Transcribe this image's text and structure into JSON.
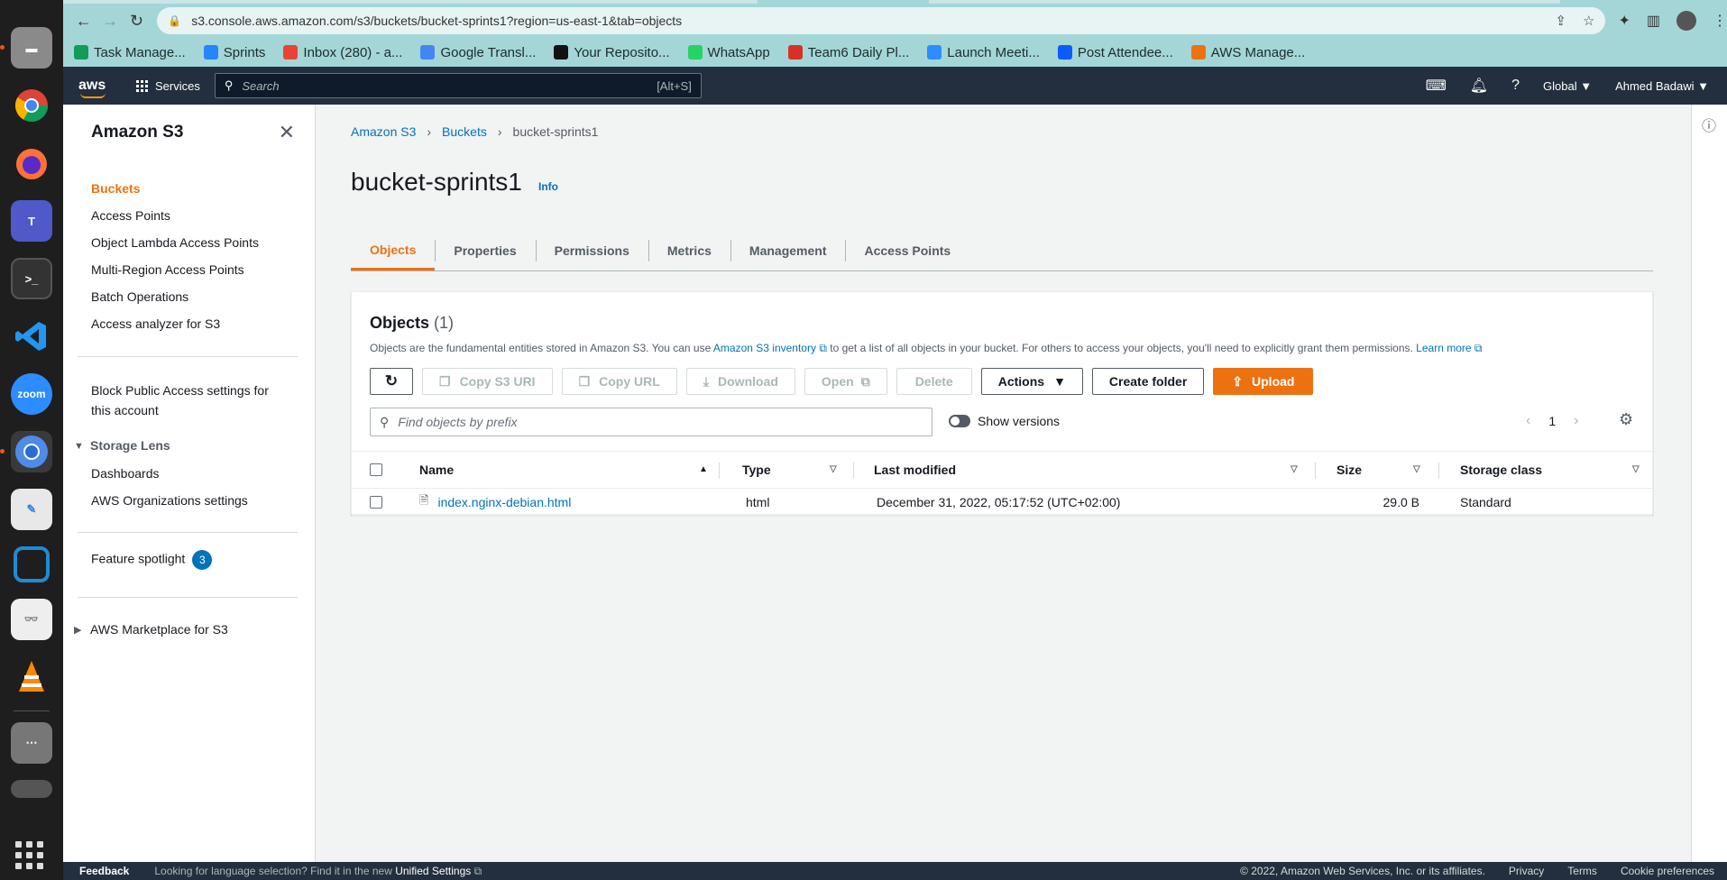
{
  "browser": {
    "url": "s3.console.aws.amazon.com/s3/buckets/bucket-sprints1?region=us-east-1&tab=objects",
    "bookmarks": [
      {
        "label": "Task Manage...",
        "icon": "sheets-icon",
        "color": "#0f9d58"
      },
      {
        "label": "Sprints",
        "icon": "jira-icon",
        "color": "#2684ff"
      },
      {
        "label": "Inbox (280) - a...",
        "icon": "gmail-icon",
        "color": "#ea4335"
      },
      {
        "label": "Google Transl...",
        "icon": "translate-icon",
        "color": "#4285f4"
      },
      {
        "label": "Your Reposito...",
        "icon": "github-icon",
        "color": "#111111"
      },
      {
        "label": "WhatsApp",
        "icon": "whatsapp-icon",
        "color": "#25d366"
      },
      {
        "label": "Team6 Daily Pl...",
        "icon": "team-icon",
        "color": "#d93025"
      },
      {
        "label": "Launch Meeti...",
        "icon": "zoom-icon",
        "color": "#2d8cff"
      },
      {
        "label": "Post Attendee...",
        "icon": "zoom-icon",
        "color": "#0b5cff"
      },
      {
        "label": "AWS Manage...",
        "icon": "aws-cube-icon",
        "color": "#ec7211"
      }
    ]
  },
  "aws_header": {
    "logo": "aws",
    "services_label": "Services",
    "search_placeholder": "Search",
    "search_shortcut": "[Alt+S]",
    "region": "Global ▼",
    "user": "Ahmed Badawi ▼"
  },
  "sidebar": {
    "title": "Amazon S3",
    "items": [
      {
        "label": "Buckets",
        "active": true
      },
      {
        "label": "Access Points"
      },
      {
        "label": "Object Lambda Access Points"
      },
      {
        "label": "Multi-Region Access Points"
      },
      {
        "label": "Batch Operations"
      },
      {
        "label": "Access analyzer for S3"
      }
    ],
    "block_public_1": "Block Public Access settings for",
    "block_public_2": "this account",
    "storage_lens": "Storage Lens",
    "storage_lens_items": [
      "Dashboards",
      "AWS Organizations settings"
    ],
    "feature_spotlight": "Feature spotlight",
    "feature_spotlight_count": "3",
    "marketplace": "AWS Marketplace for S3"
  },
  "breadcrumb": [
    "Amazon S3",
    "Buckets",
    "bucket-sprints1"
  ],
  "page": {
    "title": "bucket-sprints1",
    "info": "Info",
    "tabs": [
      "Objects",
      "Properties",
      "Permissions",
      "Metrics",
      "Management",
      "Access Points"
    ]
  },
  "objects_panel": {
    "title": "Objects",
    "count": "(1)",
    "desc_1": "Objects are the fundamental entities stored in Amazon S3. You can use ",
    "desc_link": "Amazon S3 inventory",
    "desc_2": " to get a list of all objects in your bucket. For others to access your objects, you'll need to explicitly grant them permissions. ",
    "desc_learn": "Learn more",
    "buttons": {
      "copy_s3_uri": "Copy S3 URI",
      "copy_url": "Copy URL",
      "download": "Download",
      "open": "Open",
      "delete": "Delete",
      "actions": "Actions",
      "create_folder": "Create folder",
      "upload": "Upload"
    },
    "filter_placeholder": "Find objects by prefix",
    "show_versions": "Show versions",
    "page_number": "1",
    "columns": [
      "Name",
      "Type",
      "Last modified",
      "Size",
      "Storage class"
    ],
    "rows": [
      {
        "name": "index.nginx-debian.html",
        "type": "html",
        "last_modified": "December 31, 2022, 05:17:52 (UTC+02:00)",
        "size": "29.0 B",
        "storage_class": "Standard"
      }
    ]
  },
  "footer": {
    "feedback": "Feedback",
    "lang_text": "Looking for language selection? Find it in the new ",
    "lang_link": "Unified Settings",
    "copyright": "© 2022, Amazon Web Services, Inc. or its affiliates.",
    "privacy": "Privacy",
    "terms": "Terms",
    "cookie": "Cookie preferences"
  },
  "colors": {
    "accent": "#ec7211",
    "link": "#0073bb",
    "header": "#232f3e"
  }
}
